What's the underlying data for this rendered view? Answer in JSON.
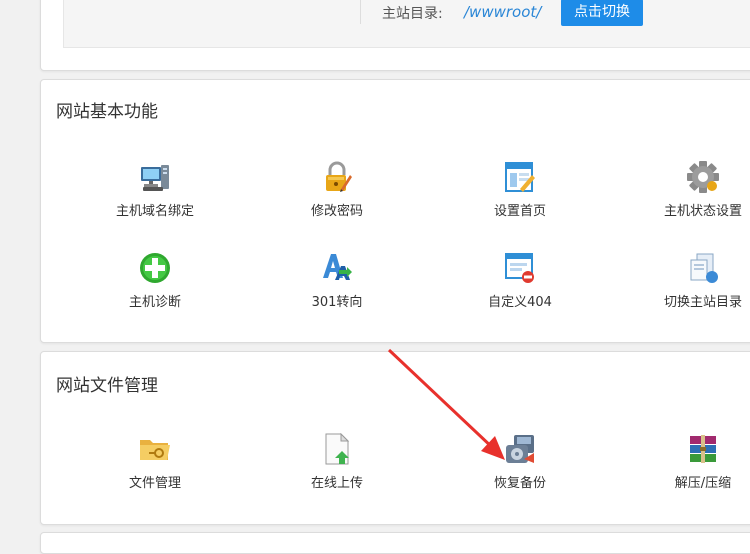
{
  "top": {
    "root_label": "主站目录:",
    "root_path": "/wwwroot/",
    "switch_button": "点击切换"
  },
  "basic": {
    "title": "网站基本功能",
    "tools": [
      {
        "label": "主机域名绑定",
        "icon": "server-monitor-icon"
      },
      {
        "label": "修改密码",
        "icon": "padlock-pencil-icon"
      },
      {
        "label": "设置首页",
        "icon": "window-edit-icon"
      },
      {
        "label": "主机状态设置",
        "icon": "gear-icon"
      },
      {
        "label": "主机诊断",
        "icon": "green-plus-icon"
      },
      {
        "label": "301转向",
        "icon": "letter-a-arrow-icon"
      },
      {
        "label": "自定义404",
        "icon": "page-error-icon"
      },
      {
        "label": "切换主站目录",
        "icon": "documents-switch-icon"
      }
    ]
  },
  "files": {
    "title": "网站文件管理",
    "tools": [
      {
        "label": "文件管理",
        "icon": "folder-key-icon"
      },
      {
        "label": "在线上传",
        "icon": "file-upload-icon"
      },
      {
        "label": "恢复备份",
        "icon": "backup-restore-icon"
      },
      {
        "label": "解压/压缩",
        "icon": "archive-books-icon"
      }
    ]
  },
  "colors": {
    "accent": "#1e8ce8",
    "path_link": "#2a86d6",
    "annotation_arrow": "#e8312c"
  }
}
